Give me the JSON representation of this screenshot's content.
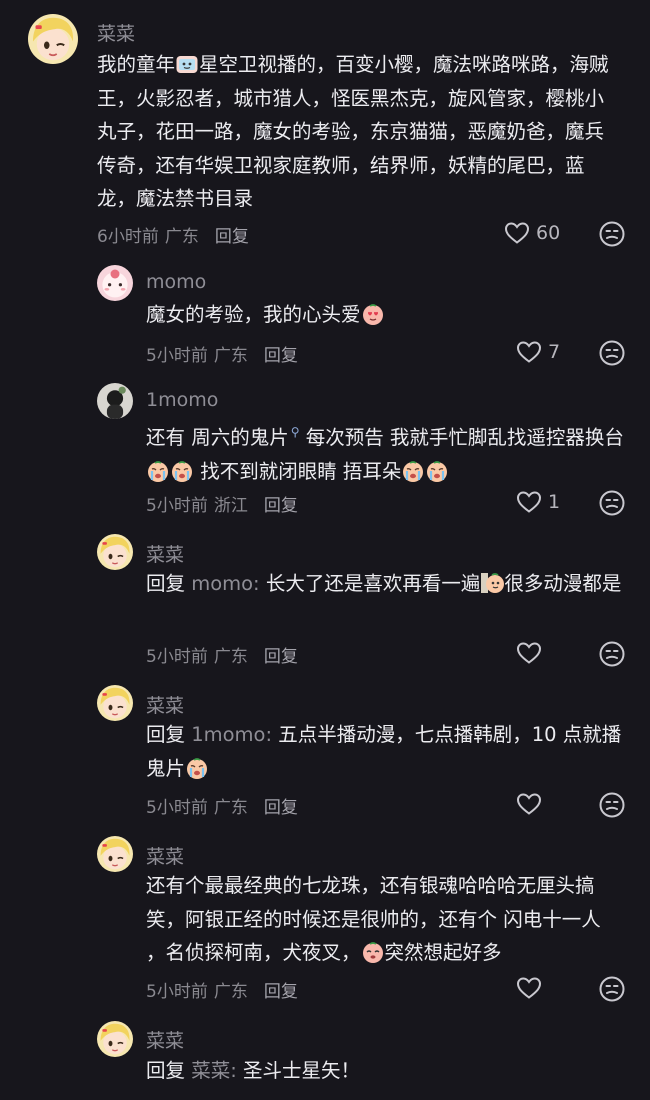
{
  "comments": [
    {
      "username": "菜菜",
      "text": [
        "我的童年",
        "星空卫视播的，百变小樱，魔法咪路咪路，海贼王，火影忍者，城市猎人，怪医黑杰克，旋风管家，樱桃小丸子，花田一路，魔女的考验，东京猫猫，恶魔奶爸，魔兵传奇，还有华娱卫视家庭教师，结界师，妖精的尾巴，蓝龙，魔法禁书目录"
      ],
      "time": "6小时前",
      "location": "广东",
      "reply_label": "回复",
      "likes": "60"
    },
    {
      "username": "momo",
      "text": [
        "魔女的考验，我的心头爱"
      ],
      "time": "5小时前",
      "location": "广东",
      "reply_label": "回复",
      "likes": "7"
    },
    {
      "username": "1momo",
      "text": [
        "还有 ",
        "周六的鬼片",
        "  每次预告 我就手忙脚乱找遥控器换台",
        "  找不到就闭眼睛 捂耳朵"
      ],
      "time": "5小时前",
      "location": "浙江",
      "reply_label": "回复",
      "likes": "1"
    },
    {
      "username": "菜菜",
      "reply_prefix": "回复 ",
      "reply_to": "momo:",
      "text": [
        " 长大了还是喜欢再看一遍",
        "很多动漫都是"
      ],
      "time": "5小时前",
      "location": "广东",
      "reply_label": "回复",
      "likes": ""
    },
    {
      "username": "菜菜",
      "reply_prefix": "回复 ",
      "reply_to": "1momo:",
      "text": [
        " 五点半播动漫，七点播韩剧，10 点就播鬼片"
      ],
      "time": "5小时前",
      "location": "广东",
      "reply_label": "回复",
      "likes": ""
    },
    {
      "username": "菜菜",
      "text": [
        "还有个最最经典的七龙珠，还有银魂哈哈哈无厘头搞笑，阿银正经的时候还是很帅的，还有个 闪电十一人 ，名侦探柯南，犬夜叉，",
        "突然想起好多"
      ],
      "time": "5小时前",
      "location": "广东",
      "reply_label": "回复",
      "likes": ""
    },
    {
      "username": "菜菜",
      "reply_prefix": "回复 ",
      "reply_to": "菜菜:",
      "text": [
        " 圣斗士星矢！"
      ],
      "time": "",
      "location": "",
      "reply_label": "",
      "likes": ""
    }
  ],
  "icons": {
    "like": "heart-outline-icon",
    "dislike": "unhappy-face-icon",
    "search": "search-icon"
  },
  "colors": {
    "background": "#17161c",
    "text": "#ececf0",
    "muted": "#8f8e96"
  }
}
